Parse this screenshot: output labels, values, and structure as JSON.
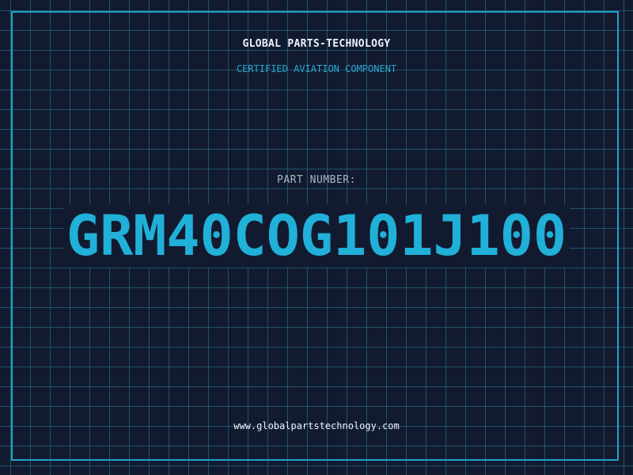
{
  "header": {
    "company": "GLOBAL PARTS-TECHNOLOGY",
    "subtitle": "CERTIFIED AVIATION COMPONENT"
  },
  "part": {
    "label": "PART NUMBER:",
    "number": "GRM40COG101J100"
  },
  "footer": {
    "website": "www.globalpartstechnology.com"
  },
  "colors": {
    "background": "#121a30",
    "grid": "#28828f",
    "accent": "#1ea3c8",
    "text": "#eef2f8"
  }
}
